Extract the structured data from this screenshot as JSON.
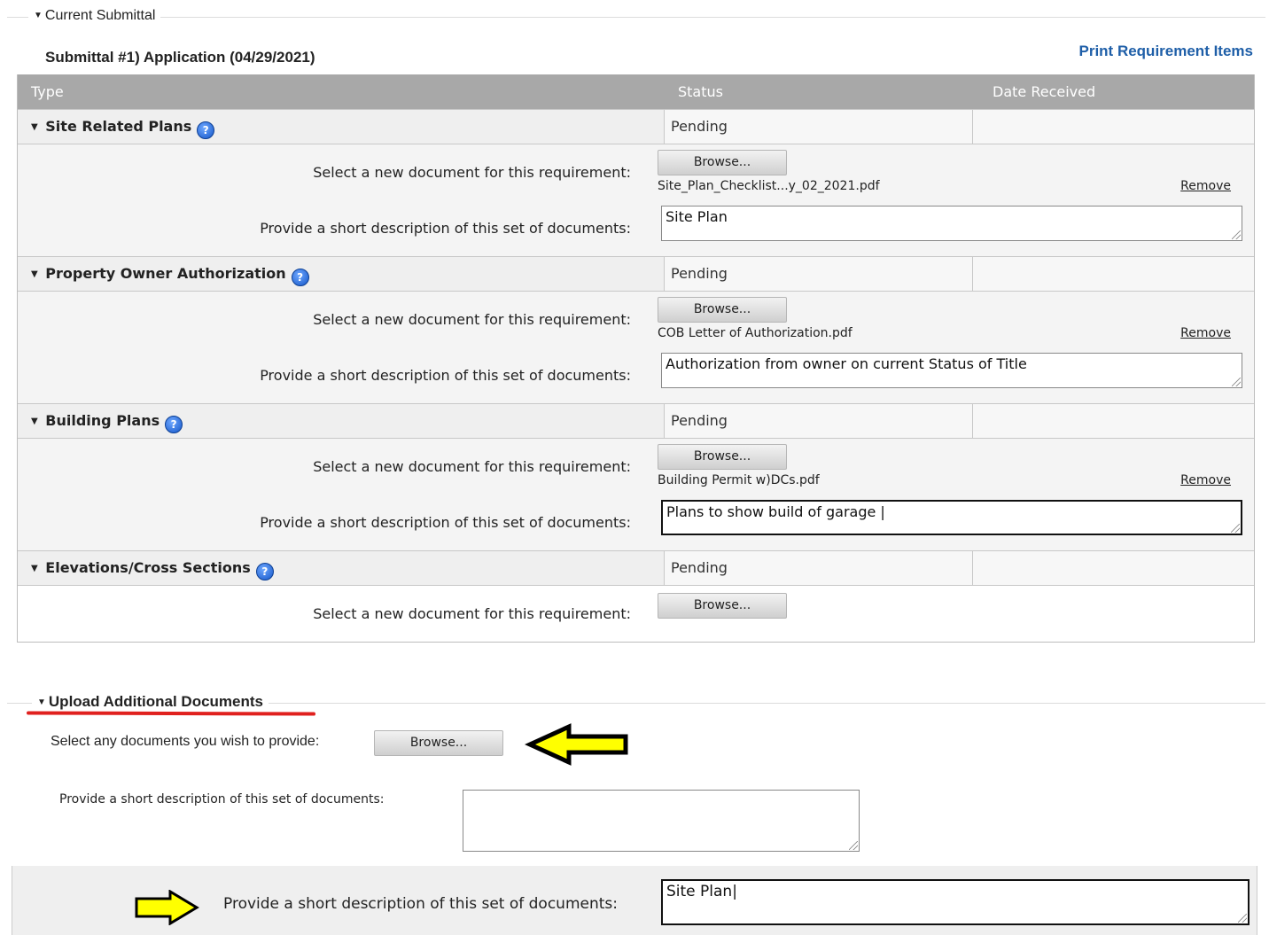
{
  "section_title": "Current Submittal",
  "submittal_title": "Submittal #1) Application (04/29/2021)",
  "print_link": "Print Requirement Items",
  "table": {
    "col_type": "Type",
    "col_status": "Status",
    "col_date": "Date Received"
  },
  "select_label": "Select a new document for this requirement:",
  "desc_label": "Provide a short description of this set of documents:",
  "browse_label": "Browse...",
  "remove_label": "Remove",
  "requirements": [
    {
      "name": "Site Related Plans",
      "status": "Pending",
      "file": "Site_Plan_Checklist...y_02_2021.pdf",
      "description": "Site Plan"
    },
    {
      "name": "Property Owner Authorization",
      "status": "Pending",
      "file": "COB Letter of Authorization.pdf",
      "description": "Authorization from owner on current Status of Title"
    },
    {
      "name": "Building Plans",
      "status": "Pending",
      "file": "Building Permit w)DCs.pdf",
      "description": "Plans to show build of garage"
    },
    {
      "name": "Elevations/Cross Sections",
      "status": "Pending"
    }
  ],
  "upload": {
    "title": "Upload Additional Documents",
    "select_label": "Select any documents you wish to provide:",
    "browse_label": "Browse...",
    "desc_label": "Provide a short description of this set of documents:"
  },
  "zoom_panel": {
    "label": "Provide a short description of this set of documents:",
    "value": "Site Plan"
  },
  "colors": {
    "arrow": "#ffff00",
    "underline": "#e0201e",
    "link": "#1f5fa8",
    "header": "#a8a8a8"
  }
}
